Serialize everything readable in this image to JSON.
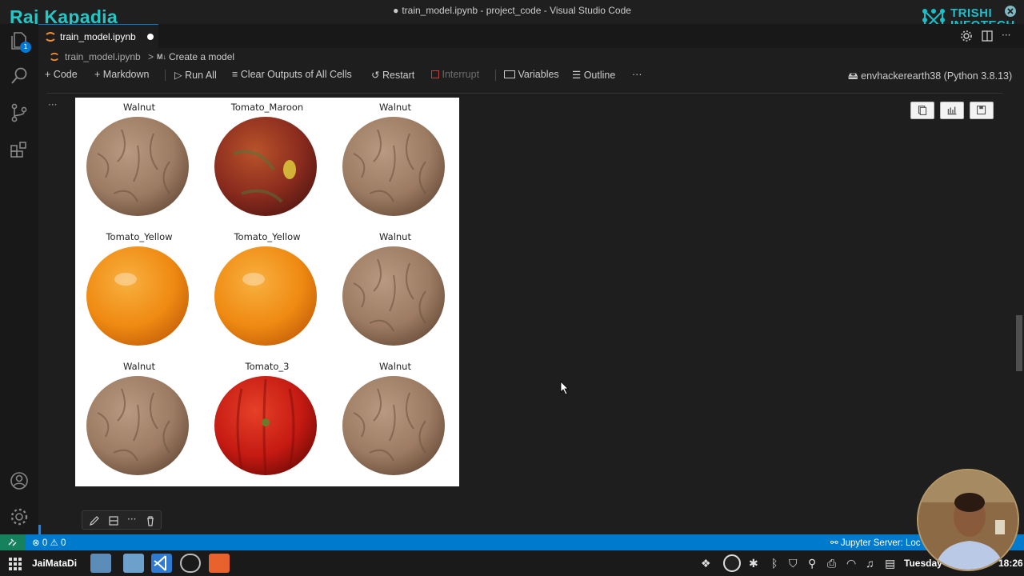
{
  "overlay": {
    "presenter_name": "Raj Kapadia",
    "brand_line1": "TRISHI",
    "brand_line2": "INFOTECH"
  },
  "window": {
    "title": "train_model.ipynb - project_code - Visual Studio Code"
  },
  "tab": {
    "label": "train_model.ipynb"
  },
  "breadcrumb": {
    "file": "train_model.ipynb",
    "separator": ">",
    "markdown_tag": "M↓",
    "section": "Create a model"
  },
  "toolbar": {
    "code": "Code",
    "markdown": "Markdown",
    "run_all": "Run All",
    "clear_outputs": "Clear Outputs of All Cells",
    "restart": "Restart",
    "interrupt": "Interrupt",
    "variables": "Variables",
    "outline": "Outline",
    "more": "···",
    "kernel": "envhackerearth38 (Python 3.8.13)"
  },
  "activity": {
    "badge_count": "1"
  },
  "output_grid": {
    "cell_more": "···",
    "images": [
      {
        "label": "Walnut",
        "kind": "walnut"
      },
      {
        "label": "Tomato_Maroon",
        "kind": "tomato-maroon"
      },
      {
        "label": "Walnut",
        "kind": "walnut"
      },
      {
        "label": "Tomato_Yellow",
        "kind": "tomato-yellow"
      },
      {
        "label": "Tomato_Yellow",
        "kind": "tomato-yellow"
      },
      {
        "label": "Walnut",
        "kind": "walnut"
      },
      {
        "label": "Walnut",
        "kind": "walnut"
      },
      {
        "label": "Tomato_3",
        "kind": "tomato-red"
      },
      {
        "label": "Walnut",
        "kind": "walnut"
      }
    ]
  },
  "status": {
    "problems": "0",
    "warnings": "0",
    "jupyter": "Jupyter Server: Loc"
  },
  "taskbar": {
    "workspace": "JaiMataDi",
    "day": "Tuesday",
    "time": "18:26"
  },
  "colors": {
    "accent": "#0078d4",
    "statusbar": "#007acc",
    "overlay_text": "#24c6c6"
  }
}
